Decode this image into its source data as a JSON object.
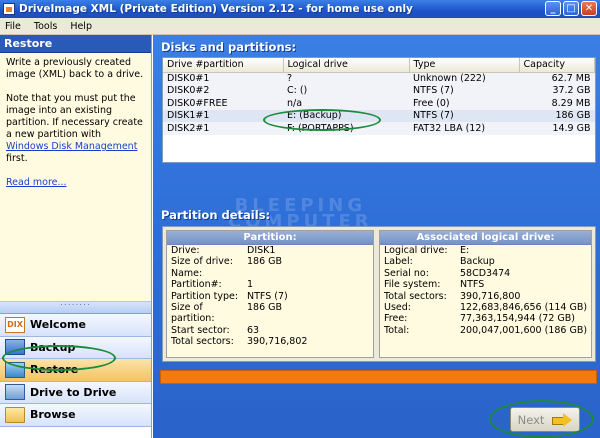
{
  "window": {
    "title": "DriveImage XML (Private Edition) Version 2.12 - for home use only",
    "minimize": "_",
    "maximize": "□",
    "close": "✕"
  },
  "menu": [
    "File",
    "Tools",
    "Help"
  ],
  "help": {
    "title": "Restore",
    "p1": "Write a previously created image (XML) back to a drive.",
    "p2_pre": "Note that you must put the image into an existing partition. If necessary create a new partition with ",
    "p2_link": "Windows Disk Management",
    "p2_post": " first.",
    "read_more": "Read more..."
  },
  "nav": [
    {
      "label": "Welcome",
      "icon": "dix-icon",
      "icon_text": "DIX"
    },
    {
      "label": "Backup",
      "icon": "backup-icon"
    },
    {
      "label": "Restore",
      "icon": "restore-icon"
    },
    {
      "label": "Drive to Drive",
      "icon": "drive-to-drive-icon"
    },
    {
      "label": "Browse",
      "icon": "folder-icon"
    }
  ],
  "disks": {
    "title": "Disks and partitions:",
    "columns": [
      "Drive #partition",
      "Logical drive",
      "Type",
      "Capacity"
    ],
    "rows": [
      [
        "DISK0#1",
        "?",
        "Unknown (222)",
        "62.7 MB"
      ],
      [
        "DISK0#2",
        "C: ()",
        "NTFS (7)",
        "37.2 GB"
      ],
      [
        "DISK0#FREE",
        "n/a",
        "Free (0)",
        "8.29 MB"
      ],
      [
        "DISK1#1",
        "E: (Backup)",
        "NTFS (7)",
        "186 GB"
      ],
      [
        "DISK2#1",
        "F: (PORTAPPS)",
        "FAT32 LBA (12)",
        "14.9 GB"
      ]
    ],
    "selected_row": 3
  },
  "details": {
    "title": "Partition details:",
    "partition": {
      "header": "Partition:",
      "rows": [
        [
          "Drive:",
          "DISK1"
        ],
        [
          "Size of drive:",
          "186 GB"
        ],
        [
          "Name:",
          ""
        ],
        [
          "Partition#:",
          "1"
        ],
        [
          "Partition type:",
          "NTFS (7)"
        ],
        [
          "Size of partition:",
          "186 GB"
        ],
        [
          "Start sector:",
          "63"
        ],
        [
          "Total sectors:",
          "390,716,802"
        ]
      ]
    },
    "logical": {
      "header": "Associated logical drive:",
      "rows": [
        [
          "Logical drive:",
          "E:"
        ],
        [
          "Label:",
          "Backup"
        ],
        [
          "Serial no:",
          "58CD3474"
        ],
        [
          "File system:",
          "NTFS"
        ],
        [
          "Total sectors:",
          "390,716,800"
        ],
        [
          "Used:",
          "122,683,846,656 (114 GB)"
        ],
        [
          "Free:",
          "77,363,154,944 (72 GB)"
        ],
        [
          "Total:",
          "200,047,001,600 (186 GB)"
        ]
      ]
    }
  },
  "watermark": [
    "BLEEPING",
    "COMPUTER"
  ],
  "next_label": "Next",
  "colors": {
    "accent": "#2a5ab8",
    "progress": "#f47a10",
    "highlight": "#1c8a3c"
  }
}
